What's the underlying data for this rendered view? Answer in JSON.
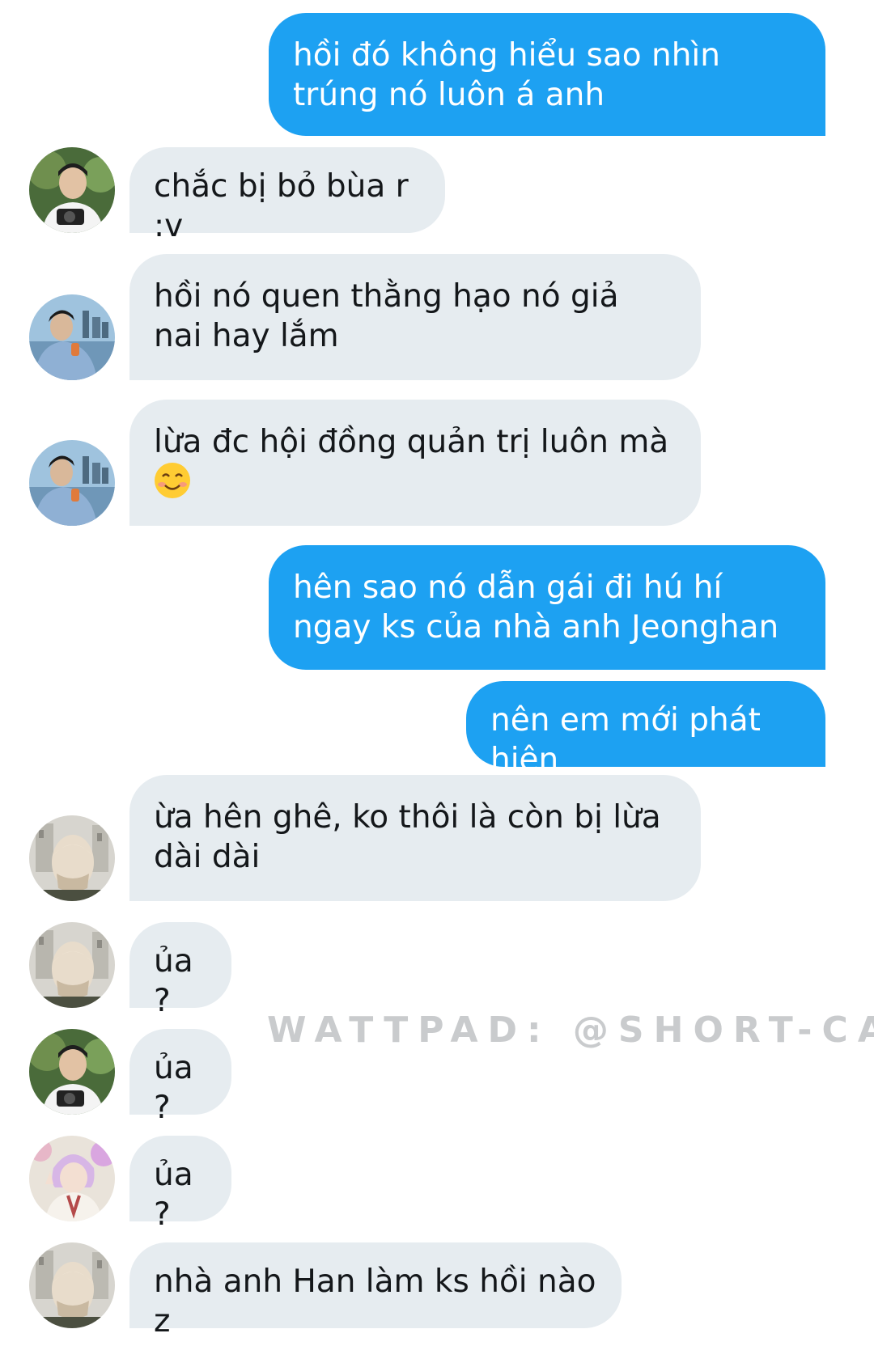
{
  "messages": [
    {
      "direction": "out",
      "text": "hồi đó không hiểu sao nhìn trúng nó luôn á anh"
    },
    {
      "direction": "in",
      "avatar": "avatar-a",
      "text": "chắc bị bỏ bùa r :v"
    },
    {
      "direction": "in",
      "avatar": "avatar-b",
      "text": "hồi nó quen thằng hạo nó giả nai hay lắm"
    },
    {
      "direction": "in",
      "avatar": "avatar-b",
      "text": "lừa đc hội đồng quản trị luôn mà",
      "emoji": "smiling-face-emoji"
    },
    {
      "direction": "out",
      "text": "hên sao nó dẫn gái đi hú hí ngay ks của nhà anh Jeonghan"
    },
    {
      "direction": "out",
      "text": "nên em mới phát hiện"
    },
    {
      "direction": "in",
      "avatar": "avatar-c",
      "text": "ừa hên ghê, ko thôi là còn bị lừa dài dài"
    },
    {
      "direction": "in",
      "avatar": "avatar-c",
      "text": "ủa?"
    },
    {
      "direction": "in",
      "avatar": "avatar-a",
      "text": "ủa?"
    },
    {
      "direction": "in",
      "avatar": "avatar-d",
      "text": "ủa?"
    },
    {
      "direction": "in",
      "avatar": "avatar-c",
      "text": "nhà anh Han làm ks hồi nào z"
    }
  ],
  "watermark": "WATTPAD: @SHORT-CA",
  "colors": {
    "outgoing_bubble": "#1da1f2",
    "incoming_bubble": "#e6ecf0",
    "incoming_text": "#14171a",
    "watermark": "#c9cbcd"
  }
}
